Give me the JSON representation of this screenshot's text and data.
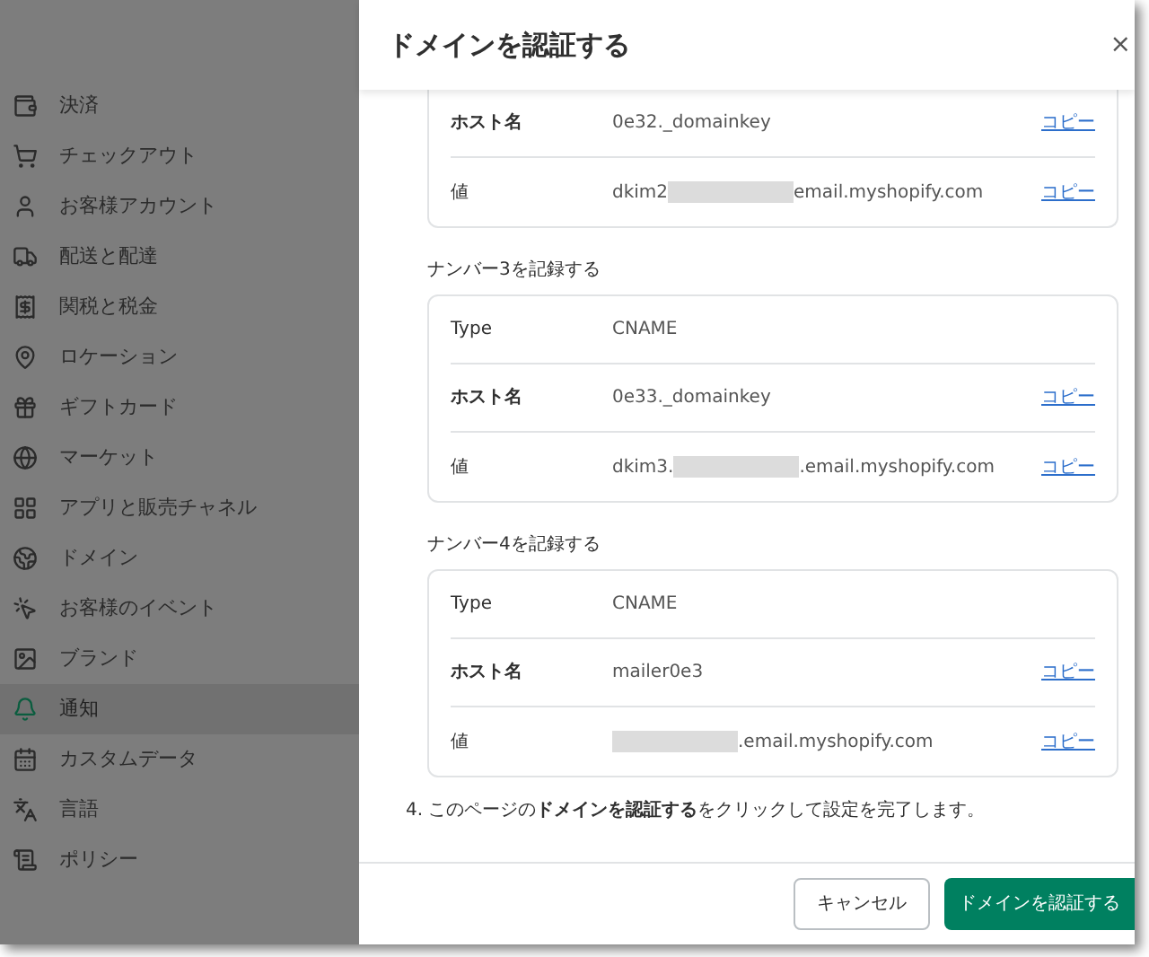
{
  "sidebar": {
    "items": [
      {
        "label": "決済",
        "selected": false
      },
      {
        "label": "チェックアウト",
        "selected": false
      },
      {
        "label": "お客様アカウント",
        "selected": false
      },
      {
        "label": "配送と配達",
        "selected": false
      },
      {
        "label": "関税と税金",
        "selected": false
      },
      {
        "label": "ロケーション",
        "selected": false
      },
      {
        "label": "ギフトカード",
        "selected": false
      },
      {
        "label": "マーケット",
        "selected": false
      },
      {
        "label": "アプリと販売チャネル",
        "selected": false
      },
      {
        "label": "ドメイン",
        "selected": false
      },
      {
        "label": "お客様のイベント",
        "selected": false
      },
      {
        "label": "ブランド",
        "selected": false
      },
      {
        "label": "通知",
        "selected": true
      },
      {
        "label": "カスタムデータ",
        "selected": false
      },
      {
        "label": "言語",
        "selected": false
      },
      {
        "label": "ポリシー",
        "selected": false
      }
    ]
  },
  "dialog": {
    "title": "ドメインを認証する",
    "close": "×",
    "records": [
      {
        "rows": [
          {
            "label": "ホスト名",
            "value_prefix": "0e32._domainkey",
            "copy": "コピー"
          },
          {
            "label": "値",
            "value_prefix": "dkim2",
            "redacted": true,
            "value_suffix": "email.myshopify.com",
            "copy": "コピー"
          }
        ]
      },
      {
        "heading": "ナンバー3を記録する",
        "rows": [
          {
            "label": "Type",
            "value_prefix": "CNAME"
          },
          {
            "label": "ホスト名",
            "value_prefix": "0e33._domainkey",
            "copy": "コピー"
          },
          {
            "label": "値",
            "value_prefix": "dkim3.",
            "redacted": true,
            "value_suffix": ".email.myshopify.com",
            "copy": "コピー"
          }
        ]
      },
      {
        "heading": "ナンバー4を記録する",
        "rows": [
          {
            "label": "Type",
            "value_prefix": "CNAME"
          },
          {
            "label": "ホスト名",
            "value_prefix": "mailer0e3",
            "copy": "コピー"
          },
          {
            "label": "値",
            "redacted": true,
            "value_suffix": ".email.myshopify.com",
            "copy": "コピー"
          }
        ]
      }
    ],
    "instruction": "4. このページの**ドメインを認証する**をクリックして設定を完了します。",
    "buttons": {
      "cancel": "キャンセル",
      "confirm": "ドメインを認証する"
    }
  }
}
